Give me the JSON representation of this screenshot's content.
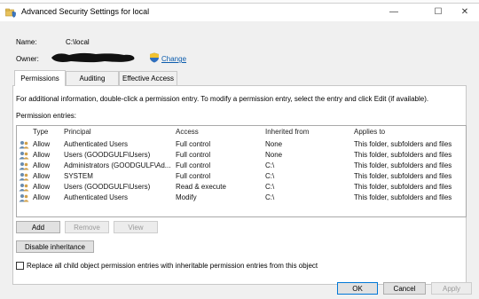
{
  "window": {
    "title": "Advanced Security Settings for local",
    "minimize_glyph": "—",
    "maximize_glyph": "☐",
    "close_glyph": "✕"
  },
  "info": {
    "name_label": "Name:",
    "name_value": "C:\\local",
    "owner_label": "Owner:",
    "change_label": "Change"
  },
  "tabs": [
    {
      "label": "Permissions",
      "active": true
    },
    {
      "label": "Auditing",
      "active": false
    },
    {
      "label": "Effective Access",
      "active": false
    }
  ],
  "instructions": "For additional information, double-click a permission entry. To modify a permission entry, select the entry and click Edit (if available).",
  "permission_entries_label": "Permission entries:",
  "table": {
    "columns": [
      "Type",
      "Principal",
      "Access",
      "Inherited from",
      "Applies to"
    ],
    "rows": [
      [
        "Allow",
        "Authenticated Users",
        "Full control",
        "None",
        "This folder, subfolders and files"
      ],
      [
        "Allow",
        "Users (GOODGULF\\Users)",
        "Full control",
        "None",
        "This folder, subfolders and files"
      ],
      [
        "Allow",
        "Administrators (GOODGULF\\Ad...",
        "Full control",
        "C:\\",
        "This folder, subfolders and files"
      ],
      [
        "Allow",
        "SYSTEM",
        "Full control",
        "C:\\",
        "This folder, subfolders and files"
      ],
      [
        "Allow",
        "Users (GOODGULF\\Users)",
        "Read & execute",
        "C:\\",
        "This folder, subfolders and files"
      ],
      [
        "Allow",
        "Authenticated Users",
        "Modify",
        "C:\\",
        "This folder, subfolders and files"
      ]
    ]
  },
  "buttons": {
    "add": "Add",
    "remove": "Remove",
    "view": "View",
    "disable_inheritance": "Disable inheritance",
    "ok": "OK",
    "cancel": "Cancel",
    "apply": "Apply"
  },
  "replace_checkbox_label": "Replace all child object permission entries with inheritable permission entries from this object",
  "colors": {
    "link": "#0b5cad",
    "accent": "#0078d7"
  }
}
